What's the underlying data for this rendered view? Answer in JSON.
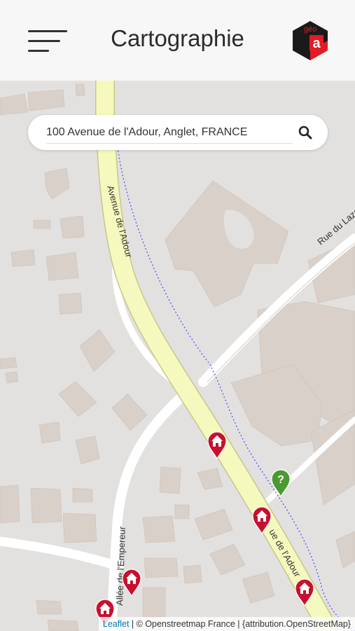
{
  "header": {
    "title": "Cartographie",
    "menu_icon": "hamburger-menu-icon",
    "logo_text": "géo a"
  },
  "search": {
    "value": "100 Avenue de l'Adour, Anglet, FRANCE",
    "icon": "search-icon"
  },
  "map": {
    "street_labels": [
      "Avenue de l'Adour",
      "Rue du Lazaret",
      "Allée de l'Empereur",
      "ue de l'Adour"
    ],
    "markers": [
      {
        "type": "house",
        "color": "#c8102e"
      },
      {
        "type": "house",
        "color": "#c8102e"
      },
      {
        "type": "house",
        "color": "#c8102e"
      },
      {
        "type": "house",
        "color": "#c8102e"
      },
      {
        "type": "house",
        "color": "#c8102e"
      },
      {
        "type": "help",
        "label": "?",
        "color": "#4a9a2e"
      }
    ]
  },
  "attribution": {
    "leaflet": "Leaflet",
    "rest": " | © Openstreetmap France | {attribution.OpenStreetMap}"
  },
  "colors": {
    "main_road": "#f6f9be",
    "main_road_edge": "#c6c68c",
    "building": "#d9d0c9",
    "land": "#e3e1df",
    "marker_red": "#c8102e",
    "marker_green": "#4a9a2e"
  }
}
